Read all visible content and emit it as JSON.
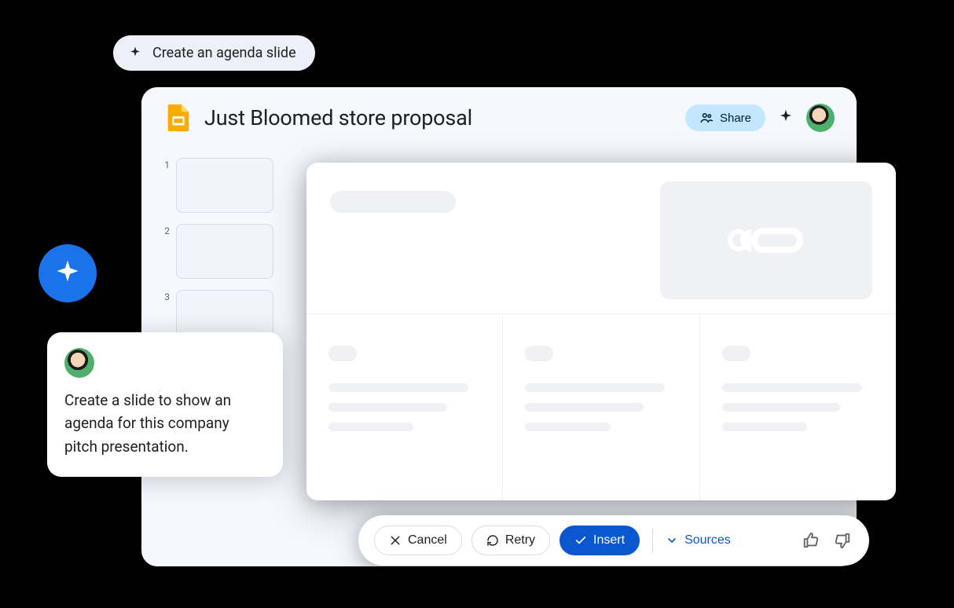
{
  "suggestion": {
    "label": "Create an agenda slide"
  },
  "header": {
    "title": "Just Bloomed store proposal",
    "share_label": "Share"
  },
  "thumbs": [
    {
      "num": "1"
    },
    {
      "num": "2"
    },
    {
      "num": "3"
    }
  ],
  "prompt": {
    "text": "Create a slide to show an agenda for this company pitch presentation."
  },
  "actions": {
    "cancel": "Cancel",
    "retry": "Retry",
    "insert": "Insert",
    "sources": "Sources"
  }
}
